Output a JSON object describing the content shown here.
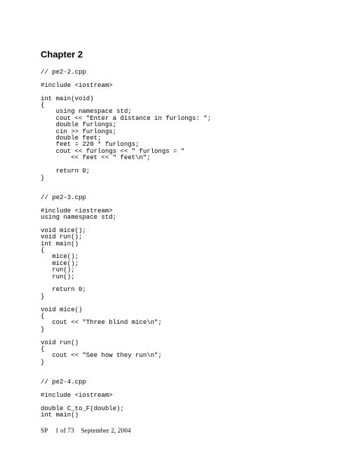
{
  "header": {
    "chapter_title": "Chapter 2"
  },
  "code_block": "// pe2-2.cpp\n\n#include <iostream>\n\nint main(void)\n{\n    using namespace std;\n    cout << \"Enter a distance in furlongs: \";\n    double furlongs;\n    cin >> furlongs;\n    double feet;\n    feet = 220 * furlongs;\n    cout << furlongs << \" furlongs = \"\n        << feet << \" feet\\n\";\n\n    return 0;\n}\n\n\n// pe2-3.cpp\n\n#include <iostream>\nusing namespace std;\n\nvoid mice();\nvoid run();\nint main()\n{\n   mice();\n   mice();\n   run();\n   run();\n\n   return 0;\n}\n\nvoid mice()\n{\n   cout << \"Three blind mice\\n\";\n}\n\nvoid run()\n{\n   cout << \"See how they run\\n\";\n}\n\n\n// pe2-4.cpp\n\n#include <iostream>\n\ndouble C_to_F(double);\nint main()",
  "footer": {
    "label": "SP",
    "page_text": "1 of 73",
    "date": "September 2, 2004"
  }
}
